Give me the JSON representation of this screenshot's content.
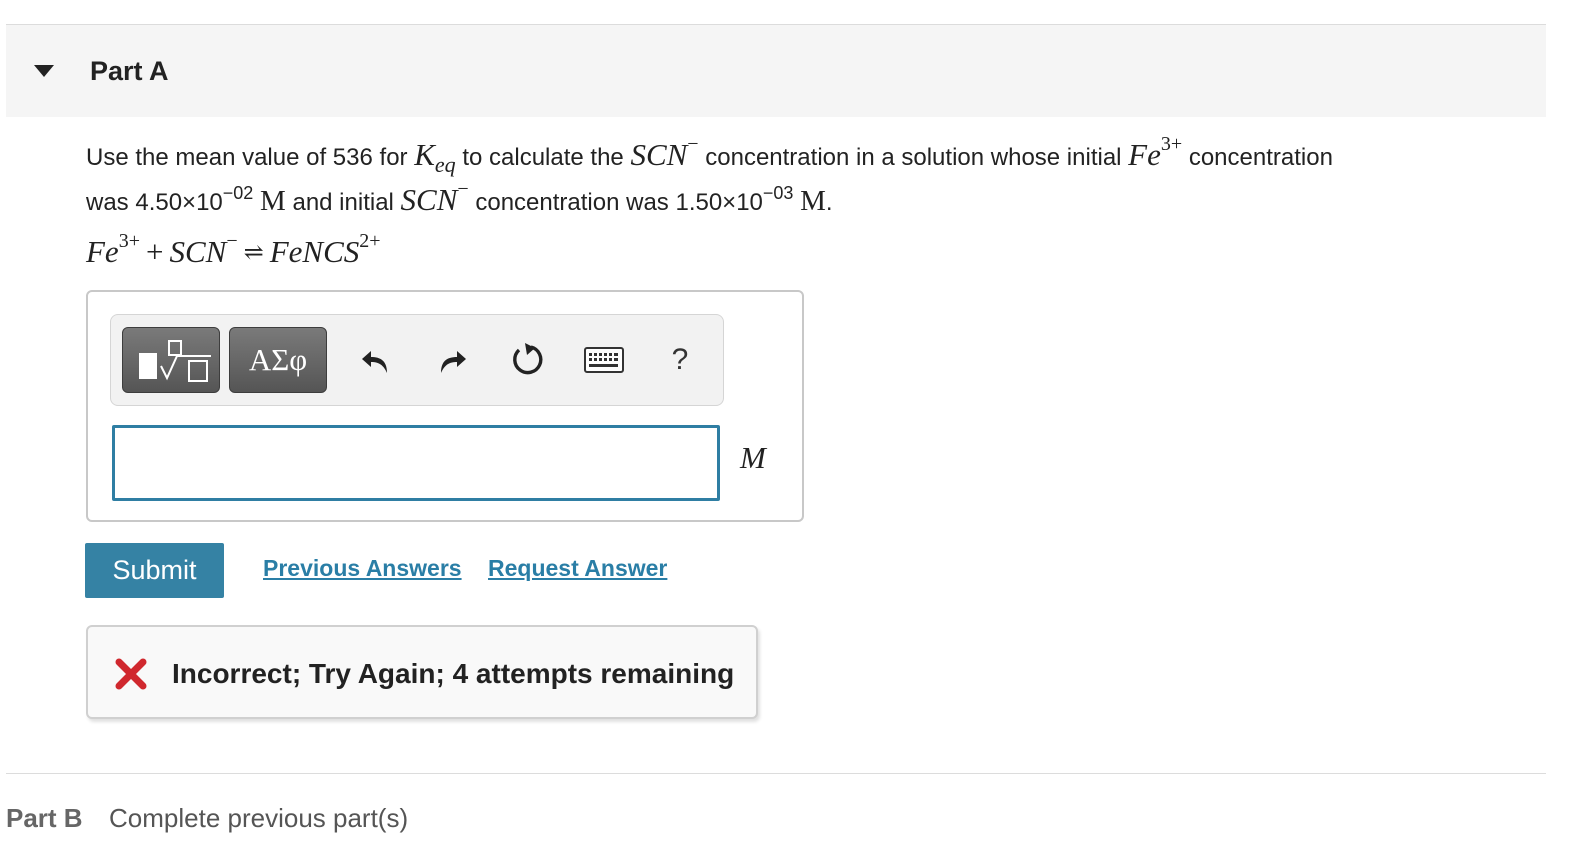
{
  "part_a": {
    "title": "Part A",
    "question": {
      "t1": "Use the mean value of 536 for ",
      "keq_K": "K",
      "keq_sub": "eq",
      "t2": " to calculate the ",
      "scn": "SCN",
      "minus": "−",
      "t3": " concentration in a solution whose initial ",
      "fe": "Fe",
      "fe_charge": "3+",
      "t4": " concentration",
      "t5": "was 4.50×10",
      "exp1": "−02",
      "unit_M": "M",
      "t6": " and initial ",
      "t7": " concentration was 1.50×10",
      "exp2": "−03",
      "t8": "."
    },
    "equation": {
      "fe": "Fe",
      "fe_charge": "3+",
      "plus": "+",
      "scn": "SCN",
      "scn_charge": "−",
      "arrow": "⇌",
      "product": "FeNCS",
      "product_charge": "2+"
    },
    "toolbar": {
      "greek_label": "ΑΣφ",
      "help_label": "?"
    },
    "answer": {
      "value": "",
      "unit": "M"
    },
    "submit_label": "Submit",
    "previous_answers_label": "Previous Answers",
    "request_answer_label": "Request Answer",
    "feedback": "Incorrect; Try Again; 4 attempts remaining"
  },
  "part_b": {
    "title": "Part B",
    "status": "Complete previous part(s)"
  },
  "colors": {
    "accent": "#3582a4",
    "link": "#2a7ea6",
    "error": "#d0282e",
    "header_bg": "#f5f5f5"
  }
}
